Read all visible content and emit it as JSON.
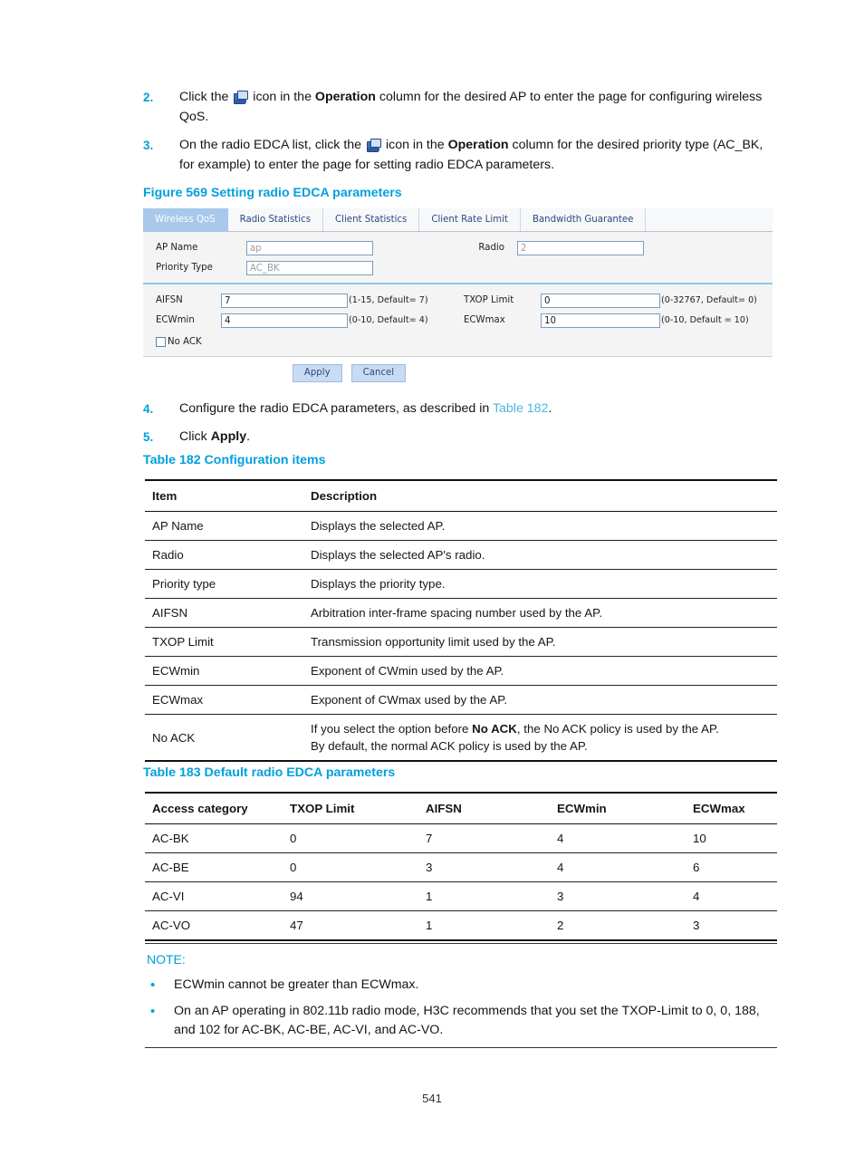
{
  "document": {
    "page_number": "541"
  },
  "steps": [
    {
      "num": "2.",
      "parts": [
        {
          "t": "text",
          "v": "Click the "
        },
        {
          "t": "icon",
          "v": "operation-icon"
        },
        {
          "t": "text",
          "v": " icon in the "
        },
        {
          "t": "bold",
          "v": "Operation"
        },
        {
          "t": "text",
          "v": " column for the desired AP to enter the page for configuring wireless QoS."
        }
      ]
    },
    {
      "num": "3.",
      "parts": [
        {
          "t": "text",
          "v": "On the radio EDCA list, click the "
        },
        {
          "t": "icon",
          "v": "operation-icon"
        },
        {
          "t": "text",
          "v": " icon in the "
        },
        {
          "t": "bold",
          "v": "Operation"
        },
        {
          "t": "text",
          "v": " column for the desired priority type (AC_BK, for example) to enter the page for setting radio EDCA parameters."
        }
      ]
    },
    {
      "num": "4.",
      "parts": [
        {
          "t": "text",
          "v": "Configure the radio EDCA parameters, as described in "
        },
        {
          "t": "link",
          "v": "Table 182"
        },
        {
          "t": "text",
          "v": "."
        }
      ]
    },
    {
      "num": "5.",
      "parts": [
        {
          "t": "text",
          "v": "Click "
        },
        {
          "t": "bold",
          "v": "Apply"
        },
        {
          "t": "text",
          "v": "."
        }
      ]
    }
  ],
  "figure": {
    "caption": "Figure 569 Setting radio EDCA parameters",
    "tabs": [
      {
        "label": "Wireless QoS",
        "active": true
      },
      {
        "label": "Radio Statistics",
        "active": false
      },
      {
        "label": "Client Statistics",
        "active": false
      },
      {
        "label": "Client Rate Limit",
        "active": false
      },
      {
        "label": "Bandwidth Guarantee",
        "active": false
      }
    ],
    "fields": {
      "ap_name_label": "AP Name",
      "ap_name_value": "ap",
      "radio_label": "Radio",
      "radio_value": "2",
      "priority_type_label": "Priority Type",
      "priority_type_value": "AC_BK",
      "aifsn_label": "AIFSN",
      "aifsn_value": "7",
      "aifsn_hint": "(1-15, Default= 7)",
      "txop_label": "TXOP Limit",
      "txop_value": "0",
      "txop_hint": "(0-32767, Default= 0)",
      "ecwmin_label": "ECWmin",
      "ecwmin_value": "4",
      "ecwmin_hint": "(0-10, Default= 4)",
      "ecwmax_label": "ECWmax",
      "ecwmax_value": "10",
      "ecwmax_hint": "(0-10, Default = 10)",
      "no_ack_label": "No ACK"
    },
    "buttons": {
      "apply": "Apply",
      "cancel": "Cancel"
    },
    "colors": {
      "active_tab_bg": "#a8c8ec",
      "panel_bg": "#f4f4f4",
      "divider": "#8ccbee",
      "button_bg": "#c7dbf3"
    }
  },
  "table182": {
    "caption": "Table 182 Configuration items",
    "headers": [
      "Item",
      "Description"
    ],
    "rows": [
      {
        "item": "AP Name",
        "desc": "Displays the selected AP."
      },
      {
        "item": "Radio",
        "desc": "Displays the selected AP's radio."
      },
      {
        "item": "Priority type",
        "desc": "Displays the priority type."
      },
      {
        "item": "AIFSN",
        "desc": "Arbitration inter-frame spacing number used by the AP."
      },
      {
        "item": "TXOP Limit",
        "desc": "Transmission opportunity limit used by the AP."
      },
      {
        "item": "ECWmin",
        "desc": "Exponent of CWmin used by the AP."
      },
      {
        "item": "ECWmax",
        "desc": "Exponent of CWmax used by the AP."
      }
    ],
    "no_ack_row": {
      "item": "No ACK",
      "line1_pre": "If you select the option before ",
      "line1_bold": "No ACK",
      "line1_post": ", the No ACK policy is used by the AP.",
      "line2": "By default, the normal ACK policy is used by the AP."
    }
  },
  "table183": {
    "caption": "Table 183 Default radio EDCA parameters",
    "headers": [
      "Access category",
      "TXOP Limit",
      "AIFSN",
      "ECWmin",
      "ECWmax"
    ],
    "rows": [
      [
        "AC-BK",
        "0",
        "7",
        "4",
        "10"
      ],
      [
        "AC-BE",
        "0",
        "3",
        "4",
        "6"
      ],
      [
        "AC-VI",
        "94",
        "1",
        "3",
        "4"
      ],
      [
        "AC-VO",
        "47",
        "1",
        "2",
        "3"
      ]
    ]
  },
  "note": {
    "title": "NOTE:",
    "items": [
      "ECWmin cannot be greater than ECWmax.",
      "On an AP operating in 802.11b radio mode, H3C recommends that you set the TXOP-Limit to 0, 0, 188, and 102 for AC-BK, AC-BE, AC-VI, and AC-VO."
    ]
  }
}
